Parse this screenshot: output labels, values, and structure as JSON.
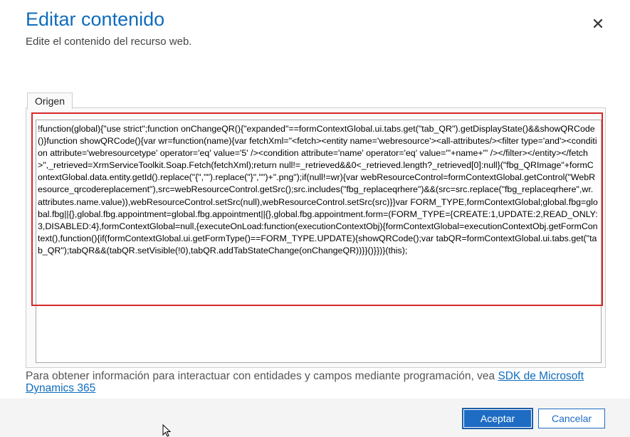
{
  "dialog": {
    "title": "Editar contenido",
    "subtitle": "Edite el contenido del recurso web.",
    "close_icon": "close-icon"
  },
  "editor": {
    "tab_label": "Origen",
    "content": "!function(global){\"use strict\";function onChangeQR(){\"expanded\"==formContextGlobal.ui.tabs.get(\"tab_QR\").getDisplayState()&&showQRCode()}function showQRCode(){var wr=function(name){var fetchXml=\"<fetch><entity name='webresource'><all-attributes/><filter type='and'><condition attribute='webresourcetype' operator='eq' value='5' /><condition attribute='name' operator='eq' value='\"+name+\"' /></filter></entity></fetch>\",_retrieved=XrmServiceToolkit.Soap.Fetch(fetchXml);return null!=_retrieved&&0<_retrieved.length?_retrieved[0]:null}(\"fbg_QRImage\"+formContextGlobal.data.entity.getId().replace(\"{\",\"\").replace(\"}\",\"\")+\".png\");if(null!=wr){var webResourceControl=formContextGlobal.getControl(\"WebResource_qrcodereplacement\"),src=webResourceControl.getSrc();src.includes(\"fbg_replaceqrhere\")&&(src=src.replace(\"fbg_replaceqrhere\",wr.attributes.name.value)),webResourceControl.setSrc(null),webResourceControl.setSrc(src)}}var FORM_TYPE,formContextGlobal;global.fbg=global.fbg||{},global.fbg.appointment=global.fbg.appointment||{},global.fbg.appointment.form=(FORM_TYPE={CREATE:1,UPDATE:2,READ_ONLY:3,DISABLED:4},formContextGlobal=null,{executeOnLoad:function(executionContextObj){formContextGlobal=executionContextObj.getFormContext(),function(){if(formContextGlobal.ui.getFormType()==FORM_TYPE.UPDATE){showQRCode();var tabQR=formContextGlobal.ui.tabs.get(\"tab_QR\");tabQR&&(tabQR.setVisible(!0),tabQR.addTabStateChange(onChangeQR))}}()}})}(this);"
  },
  "info": {
    "text": "Para obtener información para interactuar con entidades y campos mediante programación, vea ",
    "link_text": "SDK de Microsoft Dynamics 365"
  },
  "buttons": {
    "accept_label": "Aceptar",
    "cancel_label": "Cancelar"
  },
  "colors": {
    "accent": "#1e6cc4",
    "title": "#0f6cbd",
    "highlight_border": "#d42a2a"
  }
}
